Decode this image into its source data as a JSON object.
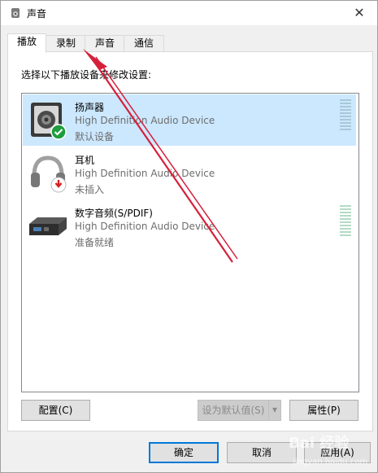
{
  "window": {
    "title": "声音",
    "close_glyph": "✕"
  },
  "tabs": [
    {
      "label": "播放",
      "active": true
    },
    {
      "label": "录制",
      "active": false
    },
    {
      "label": "声音",
      "active": false
    },
    {
      "label": "通信",
      "active": false
    }
  ],
  "instruction": "选择以下播放设备来修改设置:",
  "devices": [
    {
      "name": "扬声器",
      "description": "High Definition Audio Device",
      "status": "默认设备",
      "icon": "speaker-icon",
      "badge": "check-badge-icon",
      "selected": true,
      "meter": true
    },
    {
      "name": "耳机",
      "description": "High Definition Audio Device",
      "status": "未插入",
      "icon": "headphones-icon",
      "badge": "unplugged-badge-icon",
      "selected": false,
      "meter": false
    },
    {
      "name": "数字音频(S/PDIF)",
      "description": "High Definition Audio Device",
      "status": "准备就绪",
      "icon": "digital-audio-icon",
      "badge": "",
      "selected": false,
      "meter": true
    }
  ],
  "buttons": {
    "configure": "配置(C)",
    "set_default": "设为默认值(S)",
    "properties": "属性(P)",
    "ok": "确定",
    "cancel": "取消",
    "apply": "应用(A)"
  },
  "colors": {
    "selection": "#cce8ff",
    "annotation_arrow": "#d6203a",
    "badge_green": "#1e9e3e",
    "badge_red": "#d81e1e"
  },
  "watermark": {
    "text": "Bai 经验",
    "sub": "jingyan.baidu.com"
  }
}
